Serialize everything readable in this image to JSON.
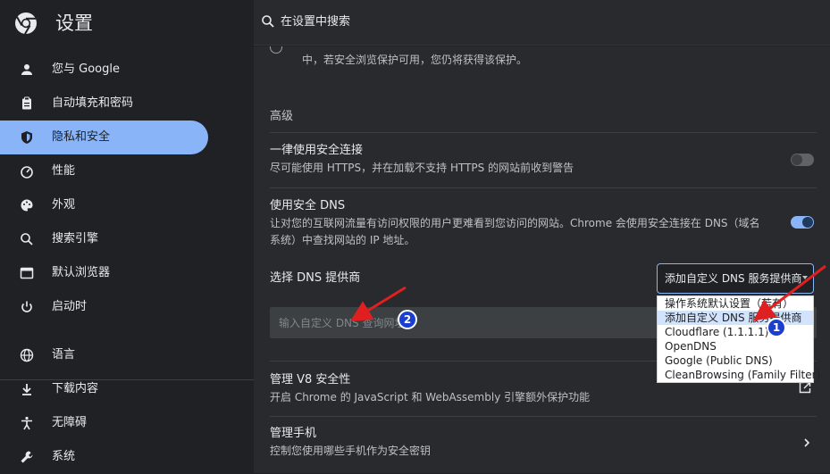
{
  "app": {
    "title": "设置"
  },
  "search": {
    "placeholder": "在设置中搜索"
  },
  "sidebar": {
    "items": [
      {
        "label": "您与 Google",
        "icon": "person-icon"
      },
      {
        "label": "自动填充和密码",
        "icon": "clipboard-icon"
      },
      {
        "label": "隐私和安全",
        "icon": "shield-icon",
        "active": true
      },
      {
        "label": "性能",
        "icon": "speedometer-icon"
      },
      {
        "label": "外观",
        "icon": "palette-icon"
      },
      {
        "label": "搜索引擎",
        "icon": "search-icon"
      },
      {
        "label": "默认浏览器",
        "icon": "browser-icon"
      },
      {
        "label": "启动时",
        "icon": "power-icon"
      },
      {
        "label": "语言",
        "icon": "globe-icon"
      },
      {
        "label": "下载内容",
        "icon": "download-icon"
      },
      {
        "label": "无障碍",
        "icon": "accessibility-icon"
      },
      {
        "label": "系统",
        "icon": "wrench-icon"
      }
    ]
  },
  "main": {
    "cut_text": "中，若安全浏览保护可用，您仍将获得该保护。",
    "section_advanced": "高级",
    "always_secure": {
      "title": "一律使用安全连接",
      "desc": "尽可能使用 HTTPS，并在加载不支持 HTTPS 的网站前收到警告",
      "enabled": false
    },
    "secure_dns": {
      "title": "使用安全 DNS",
      "desc_line1": "让对您的互联网流量有访问权限的用户更难看到您访问的网站。Chrome 会使用安全连接在 DNS（域名",
      "desc_line2": "系统）中查找网站的 IP 地址。",
      "enabled": true
    },
    "dns_provider": {
      "label": "选择 DNS 提供商",
      "selected": "添加自定义 DNS 服务提供商",
      "options": [
        "操作系统默认设置（若有）",
        "添加自定义 DNS 服务提供商",
        "Cloudflare (1.1.1.1)",
        "OpenDNS",
        "Google (Public DNS)",
        "CleanBrowsing (Family Filter)"
      ],
      "selected_index": 1,
      "input_placeholder": "输入自定义 DNS 查询网址"
    },
    "v8": {
      "title": "管理 V8 安全性",
      "desc": "开启 Chrome 的 JavaScript 和 WebAssembly 引擎额外保护功能"
    },
    "phones": {
      "title": "管理手机",
      "desc": "控制您使用哪些手机作为安全密钥"
    }
  },
  "annotations": {
    "badge1": "1",
    "badge2": "2",
    "arrow_color": "#e02020"
  },
  "colors": {
    "accent": "#8ab4f8",
    "background": "#202124",
    "panel": "#292a2d"
  }
}
